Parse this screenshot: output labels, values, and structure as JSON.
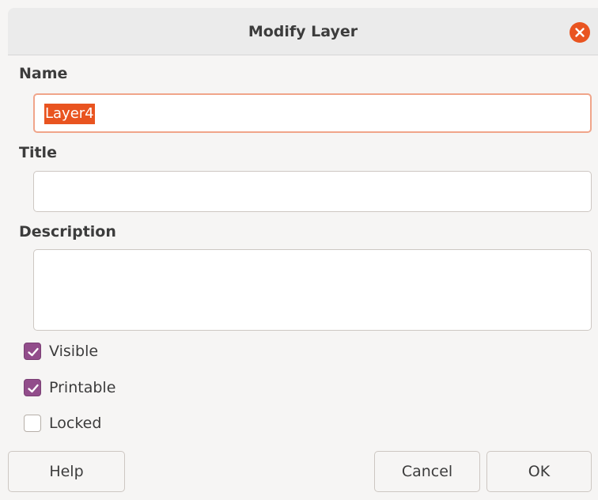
{
  "dialog": {
    "title": "Modify Layer",
    "close_icon": "close-icon"
  },
  "fields": {
    "name_label": "Name",
    "name_value": "Layer4",
    "title_label": "Title",
    "title_value": "",
    "description_label": "Description",
    "description_value": ""
  },
  "checkboxes": [
    {
      "label": "Visible",
      "checked": true
    },
    {
      "label": "Printable",
      "checked": true
    },
    {
      "label": "Locked",
      "checked": false
    }
  ],
  "buttons": {
    "help": "Help",
    "cancel": "Cancel",
    "ok": "OK"
  },
  "colors": {
    "accent": "#e95420",
    "checkbox": "#924d8b"
  }
}
